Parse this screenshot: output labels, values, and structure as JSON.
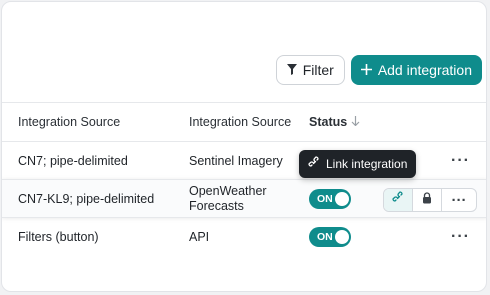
{
  "toolbar": {
    "filter_label": "Filter",
    "add_label": "Add integration"
  },
  "table": {
    "headers": [
      "Integration Source",
      "Integration Source",
      "Status"
    ],
    "rows": [
      {
        "name": "CN7; pipe-delimited",
        "source": "Sentinel Imagery",
        "status": ""
      },
      {
        "name": "CN7-KL9; pipe-delimited",
        "source_line1": "OpenWeather",
        "source_line2": "Forecasts",
        "status": "ON"
      },
      {
        "name": "Filters (button)",
        "source": "API",
        "status": "ON"
      }
    ]
  },
  "tooltip": {
    "label": "Link integration"
  },
  "colors": {
    "accent": "#0f8c8c",
    "tooltip_bg": "#1f2328"
  },
  "icons": [
    "filter-icon",
    "plus-icon",
    "sort-down-icon",
    "link-icon",
    "lock-icon",
    "more-icon"
  ]
}
